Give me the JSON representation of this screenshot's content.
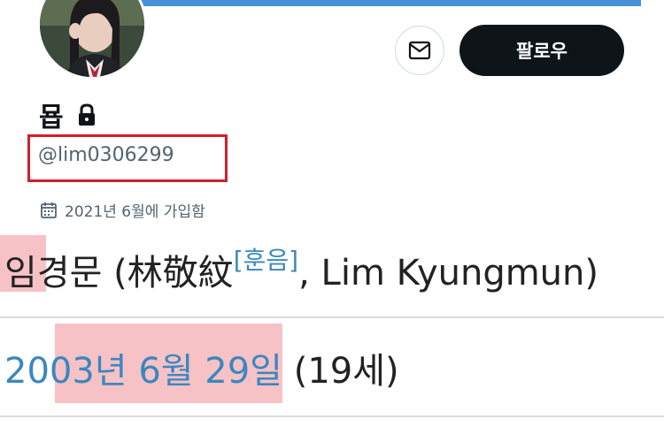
{
  "profile": {
    "display_name": "묩",
    "handle": "@lim0306299",
    "joined": "2021년 6월에 가입함",
    "follow_label": "팔로우",
    "avatar_icon": "profile-photo",
    "message_icon": "mail-icon",
    "lock_icon": "lock-icon",
    "calendar_icon": "calendar-icon"
  },
  "wiki": {
    "name_highlight": "임",
    "name_rest": "경문 (林敬紋",
    "hunum": "[훈음]",
    "name_roman": ", Lim Kyungmun)",
    "birth_year": "2003년",
    "birth_date": " 6월 29일",
    "age": " (19세)"
  },
  "colors": {
    "banner": "#4a90d9",
    "highlight_box": "#d0202a",
    "marker": "#f6b7bb",
    "link": "#3a87c0"
  }
}
